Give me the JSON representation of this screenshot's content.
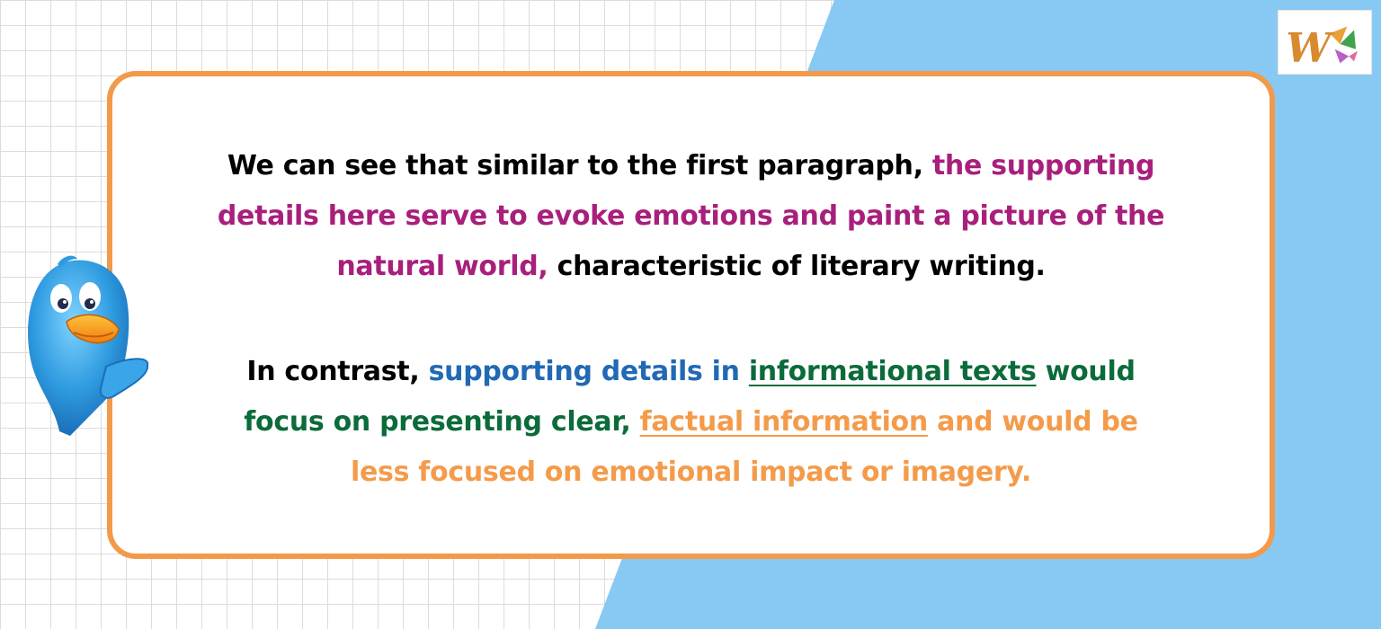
{
  "logo": {
    "letter": "W"
  },
  "paragraph1": {
    "line1": {
      "a": "We can see that similar to the first paragraph, ",
      "b": "the supporting"
    },
    "line2": {
      "a": "details here serve to evoke emotions and paint a picture of the"
    },
    "line3": {
      "a": "natural world, ",
      "b": "characteristic of literary writing."
    }
  },
  "paragraph2": {
    "line1": {
      "a": "In contrast, ",
      "b": "supporting details in ",
      "c": "informational texts",
      "d": " would"
    },
    "line2": {
      "a": "focus on presenting clear, ",
      "b": "factual information",
      "c": " and would be"
    },
    "line3": {
      "a": "less focused on emotional impact or imagery."
    }
  },
  "colors": {
    "card_border": "#f39a4a",
    "panel_blue": "#87c9f2",
    "magenta": "#a81f7c",
    "blue": "#2169b4",
    "green": "#0b6b3a",
    "orange": "#f49b4b"
  },
  "icons": {
    "logo": "w-logo-icon",
    "mascot": "blue-bird-mascot-icon"
  }
}
